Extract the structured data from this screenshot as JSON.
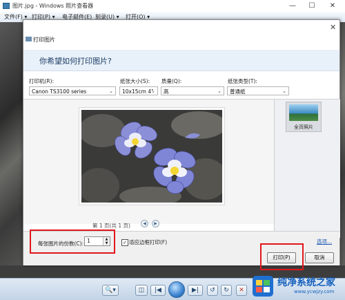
{
  "window": {
    "title": "图片.jpg - Windows 照片查看器",
    "controls": [
      "—",
      "☐",
      "✕"
    ]
  },
  "menu": [
    {
      "label": "文件(F) ▾"
    },
    {
      "label": "打印(P) ▾"
    },
    {
      "label": "电子邮件(E)"
    },
    {
      "label": "刻录(U) ▾"
    },
    {
      "label": "打开(O) ▾"
    }
  ],
  "dialog": {
    "title": "打印图片",
    "heading": "你希望如何打印图片?",
    "close": "✕",
    "printer": {
      "label": "打印机(R):",
      "value": "Canon TS3100 series"
    },
    "paper_size": {
      "label": "纸张大小(S):",
      "value": "10x15cm 4\""
    },
    "quality": {
      "label": "质量(Q):",
      "value": "高"
    },
    "paper_type": {
      "label": "纸张类型(T):",
      "value": "普通纸"
    },
    "page_info": "第 1 页(共 1 页)",
    "layout_option": "全页照片",
    "copies": {
      "label": "每张图片的份数(C):",
      "value": "1"
    },
    "fit_frame": {
      "label": "适应边框打印(F)",
      "checked": true
    },
    "options_link": "选项...",
    "print_button": "打印(P)",
    "cancel_button": "取消"
  },
  "watermark": {
    "name": "纯净系统之家",
    "url": "www.ycwjzy.com"
  },
  "colors": {
    "highlight": "#e0161b",
    "accent": "#1660bd",
    "banner": "#e8f0f9"
  }
}
